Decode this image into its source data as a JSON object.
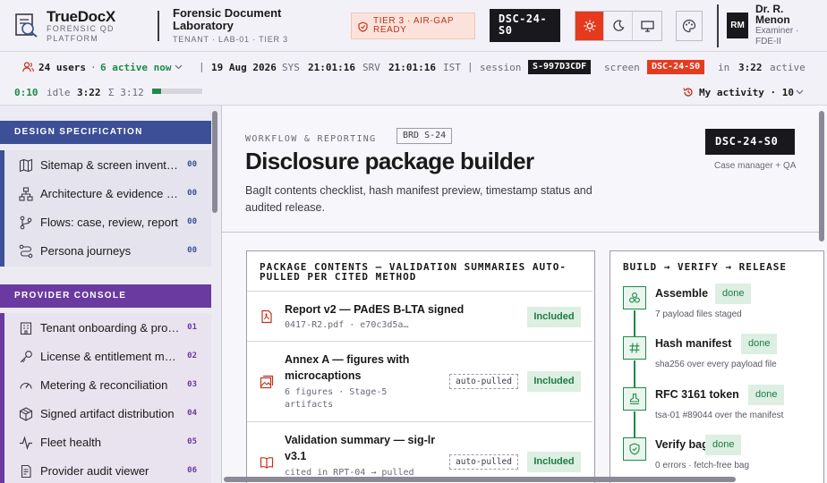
{
  "brand": {
    "name": "TrueDocX",
    "subtitle": "FORENSIC QD PLATFORM"
  },
  "lab": {
    "title": "Forensic Document Laboratory",
    "subtitle": "TENANT · LAB-01 · TIER 3"
  },
  "tier_badge": "TIER 3 · AIR-GAP READY",
  "case_chip": "DSC-24-S0",
  "theme": {
    "options": [
      "light",
      "dark",
      "system"
    ],
    "active": "light"
  },
  "user": {
    "initials": "RM",
    "name": "Dr. R. Menon",
    "role": "Examiner · FDE-II"
  },
  "status": {
    "users": "24 users",
    "active": "6 active now",
    "date": "19 Aug 2026",
    "sys_label": "SYS",
    "sys_time": "21:01:16",
    "srv_label": "SRV",
    "srv_time": "21:01:16",
    "tz": "IST",
    "session_label": "session",
    "session_id": "S-997D3CDF",
    "screen_label": "screen",
    "screen_id": "DSC-24-S0",
    "in_label": "in",
    "in_time": "3:22",
    "active_label": "active",
    "active_time": "0:10",
    "idle_label": "idle",
    "idle_time": "3:22",
    "sum_label": "Σ 3:12",
    "progress": 0.18,
    "my_activity": "My activity · 10"
  },
  "sidebar": {
    "sections": [
      {
        "title": "DESIGN SPECIFICATION",
        "color": "#3d4f96",
        "items": [
          {
            "label": "Sitemap & screen inventory",
            "count": "00",
            "icon": "map-icon"
          },
          {
            "label": "Architecture & evidence s...",
            "count": "00",
            "icon": "architecture-icon"
          },
          {
            "label": "Flows: case, review, report",
            "count": "00",
            "icon": "flow-icon"
          },
          {
            "label": "Persona journeys",
            "count": "00",
            "icon": "journey-icon"
          }
        ]
      },
      {
        "title": "PROVIDER CONSOLE",
        "color": "#6b3aa0",
        "items": [
          {
            "label": "Tenant onboarding & prov...",
            "count": "01",
            "icon": "building-icon"
          },
          {
            "label": "License & entitlement ma...",
            "count": "02",
            "icon": "key-icon"
          },
          {
            "label": "Metering & reconciliation",
            "count": "03",
            "icon": "gauge-icon"
          },
          {
            "label": "Signed artifact distribution",
            "count": "04",
            "icon": "package-icon"
          },
          {
            "label": "Fleet health",
            "count": "05",
            "icon": "pulse-icon"
          },
          {
            "label": "Provider audit viewer",
            "count": "06",
            "icon": "audit-icon"
          }
        ]
      }
    ]
  },
  "page": {
    "eyebrow": "WORKFLOW & REPORTING",
    "brd": "BRD S-24",
    "title": "Disclosure package builder",
    "description": "BagIt contents checklist, hash manifest preview, timestamp status and audited release.",
    "case_chip": "DSC-24-S0",
    "case_role": "Case manager + QA"
  },
  "contents": {
    "title": "PACKAGE CONTENTS — VALIDATION SUMMARIES AUTO-PULLED PER CITED METHOD",
    "rows": [
      {
        "title": "Report v2 — PAdES B-LTA signed",
        "meta": "0417-R2.pdf · e70c3d5a…",
        "auto": "",
        "status": "Included",
        "icon": "pdf-icon"
      },
      {
        "title": "Annex A — figures with microcaptions",
        "meta": "6 figures · Stage-5 artifacts",
        "auto": "auto-pulled",
        "status": "Included",
        "icon": "image-icon"
      },
      {
        "title": "Validation summary — sig-lr v3.1",
        "meta": "cited in RPT-04 → pulled",
        "auto": "auto-pulled",
        "status": "Included",
        "icon": "book-icon"
      }
    ]
  },
  "pipeline": {
    "title": "BUILD → VERIFY → RELEASE",
    "steps": [
      {
        "name": "Assemble",
        "status": "done",
        "meta": "7 payload files staged",
        "icon": "assemble-icon"
      },
      {
        "name": "Hash manifest",
        "status": "done",
        "meta": "sha256 over every payload file",
        "icon": "hash-icon"
      },
      {
        "name": "RFC 3161 token",
        "status": "done",
        "meta": "tsa-01 #89044 over the manifest",
        "icon": "stamp-icon"
      },
      {
        "name": "Verify bag",
        "status": "done",
        "meta": "0 errors · fetch-free bag",
        "icon": "shield-icon"
      }
    ]
  }
}
